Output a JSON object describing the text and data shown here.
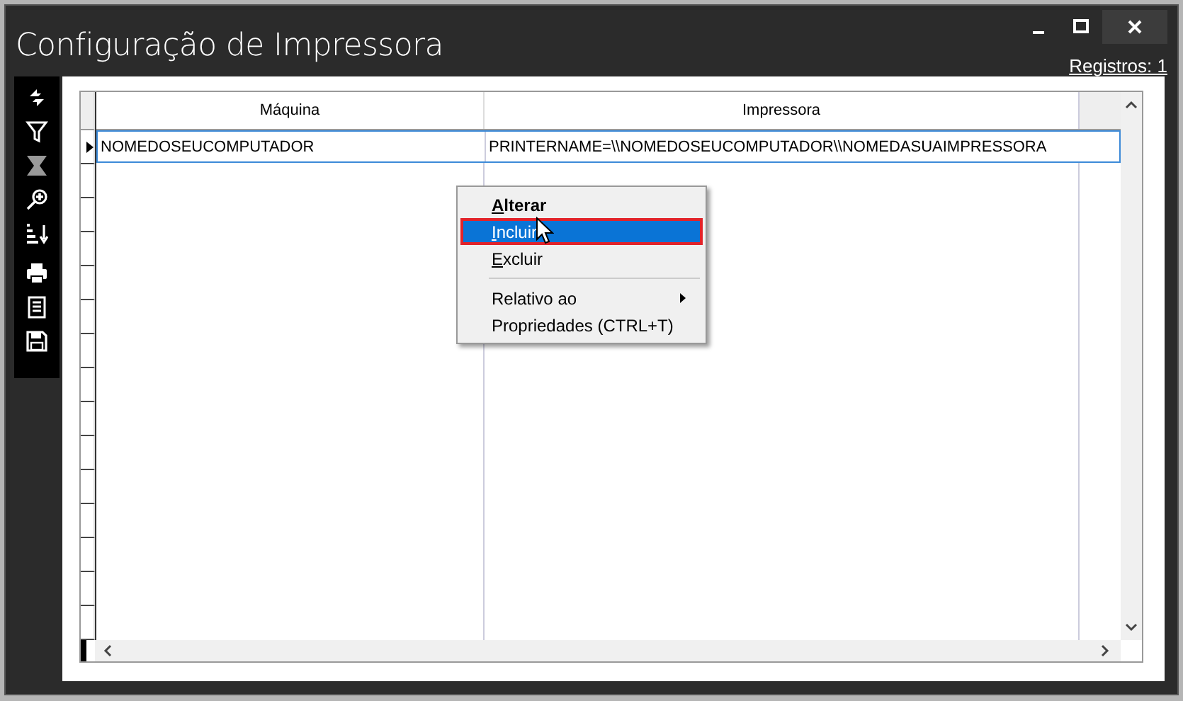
{
  "window": {
    "title": "Configuração de Impressora"
  },
  "records_link": "Registros: 1",
  "table": {
    "columns": [
      "Máquina",
      "Impressora"
    ],
    "rows": [
      {
        "cells": [
          "NOMEDOSEUCOMPUTADOR",
          "PRINTERNAME=\\\\NOMEDOSEUCOMPUTADOR\\\\NOMEDASUAIMPRESSORA"
        ],
        "selected": true
      }
    ]
  },
  "context_menu": {
    "items": [
      {
        "kind": "item",
        "label": "Alterar",
        "default": true,
        "mnemonic": true,
        "selected": false
      },
      {
        "kind": "item",
        "label": "Incluir",
        "default": false,
        "mnemonic": true,
        "selected": true
      },
      {
        "kind": "item",
        "label": "Excluir",
        "default": false,
        "mnemonic": true,
        "selected": false
      },
      {
        "kind": "separator"
      },
      {
        "kind": "submenu",
        "label": "Relativo ao",
        "default": false,
        "mnemonic": false,
        "selected": false
      },
      {
        "kind": "item",
        "label": "Propriedades (CTRL+T)",
        "default": false,
        "mnemonic": false,
        "selected": false
      }
    ]
  }
}
